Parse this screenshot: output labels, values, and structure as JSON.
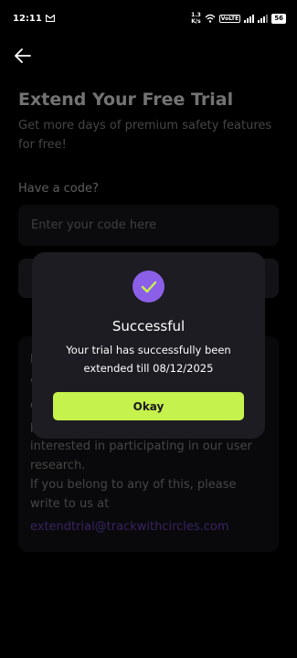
{
  "status_bar": {
    "time": "12:11",
    "speed_value": "1.3",
    "speed_unit": "K/s",
    "volte": "VoLTE",
    "battery": "56"
  },
  "header": {
    "title": "Extend Your Free Trial",
    "subtitle": "Get more days of premium safety features for free!"
  },
  "form": {
    "code_label": "Have a code?",
    "code_placeholder": "Enter your code here"
  },
  "info": {
    "fragments": [
      "I",
      "v",
      "c",
      "p"
    ],
    "body": "interested in participating in our user research.\nIf you belong to any of this, please write to us at",
    "email": "extendtrial@trackwithcircles.com"
  },
  "dialog": {
    "title": "Successful",
    "message": "Your trial has successfully been extended till 08/12/2025",
    "okay_label": "Okay"
  },
  "colors": {
    "accent_purple": "#8c5fe8",
    "okay_green": "#c6f24d",
    "email_link": "#7b4fd6"
  }
}
